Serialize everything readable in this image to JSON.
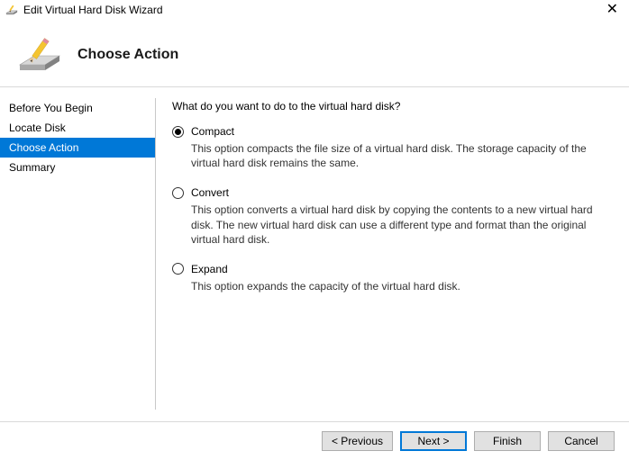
{
  "window": {
    "title": "Edit Virtual Hard Disk Wizard"
  },
  "header": {
    "title": "Choose Action"
  },
  "sidebar": {
    "items": [
      {
        "label": "Before You Begin",
        "selected": false
      },
      {
        "label": "Locate Disk",
        "selected": false
      },
      {
        "label": "Choose Action",
        "selected": true
      },
      {
        "label": "Summary",
        "selected": false
      }
    ]
  },
  "content": {
    "prompt": "What do you want to do to the virtual hard disk?",
    "options": [
      {
        "label": "Compact",
        "description": "This option compacts the file size of a virtual hard disk. The storage capacity of the virtual hard disk remains the same.",
        "checked": true
      },
      {
        "label": "Convert",
        "description": "This option converts a virtual hard disk by copying the contents to a new virtual hard disk. The new virtual hard disk can use a different type and format than the original virtual hard disk.",
        "checked": false
      },
      {
        "label": "Expand",
        "description": "This option expands the capacity of the virtual hard disk.",
        "checked": false
      }
    ]
  },
  "footer": {
    "previous": "< Previous",
    "next": "Next >",
    "finish": "Finish",
    "cancel": "Cancel"
  }
}
